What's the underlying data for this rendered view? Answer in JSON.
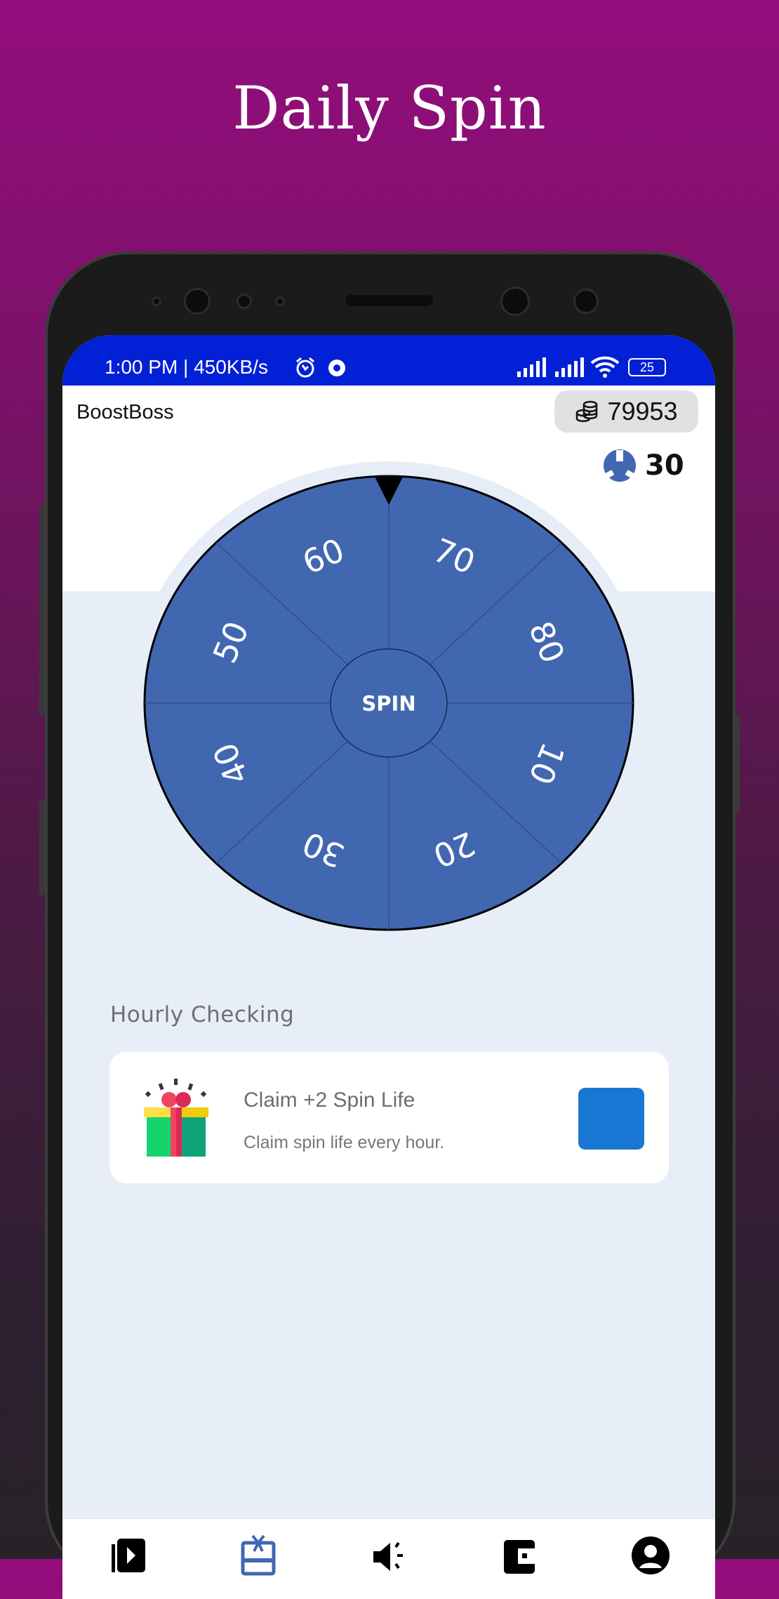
{
  "banner_title": "Daily Spin",
  "status_bar": {
    "time_speed": "1:00 PM | 450KB/s",
    "battery": "25"
  },
  "header": {
    "app_name": "BoostBoss",
    "coins": "79953",
    "spins_left": "30"
  },
  "wheel": {
    "center_label": "SPIN",
    "segments": [
      "70",
      "80",
      "10",
      "20",
      "30",
      "40",
      "50",
      "60"
    ],
    "color": "#4167b1"
  },
  "hourly": {
    "section_title": "Hourly Checking",
    "card_title": "Claim +2 Spin Life",
    "card_subtitle": "Claim spin life every hour.",
    "button_color": "#1976d2"
  },
  "bottom_nav": {
    "items": [
      {
        "icon": "video-play-icon"
      },
      {
        "icon": "gift-icon",
        "active": true
      },
      {
        "icon": "megaphone-icon"
      },
      {
        "icon": "wallet-icon"
      },
      {
        "icon": "account-icon"
      }
    ],
    "active_color": "#4167b1"
  }
}
